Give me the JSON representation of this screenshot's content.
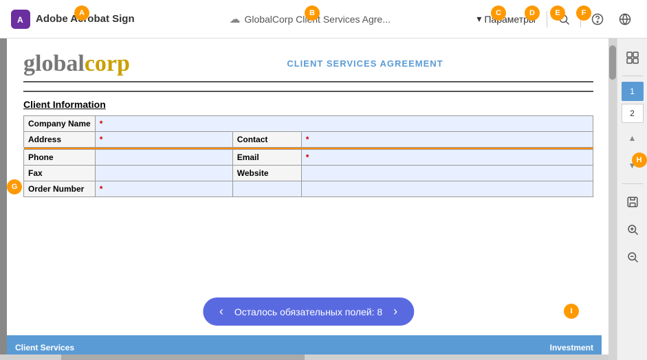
{
  "header": {
    "logo_text": "Adobe Acrobat Sign",
    "document_title": "GlobalCorp Client Services Agre...",
    "cloud_icon": "☁",
    "params_label": "Параметры",
    "chevron": "▾",
    "search_icon": "🔍",
    "help_icon": "?",
    "globe_icon": "🌐"
  },
  "annotations": {
    "A": "A",
    "B": "B",
    "C": "C",
    "D": "D",
    "E": "E",
    "F": "F",
    "G": "G",
    "H": "H",
    "I": "I"
  },
  "document": {
    "logo_left": "global",
    "logo_right": "corp",
    "agreement_title": "CLIENT SERVICES AGREEMENT",
    "section_title": "Client Information",
    "fields": [
      {
        "label": "Company Name",
        "value": "*",
        "colspan": true
      },
      {
        "label": "Address",
        "value": "*",
        "side_label": "Contact",
        "side_value": "*"
      },
      {
        "label": "Phone",
        "value": "",
        "side_label": "Email",
        "side_value": "*"
      },
      {
        "label": "Fax",
        "value": "",
        "side_label": "Website",
        "side_value": ""
      },
      {
        "label": "Order Number",
        "value": "*",
        "side_label": "",
        "side_value": ""
      }
    ],
    "required_bar": {
      "text": "Осталось обязательных полей: 8",
      "prev": "‹",
      "next": "›"
    },
    "footer_left": "Client Services",
    "footer_right": "Investment"
  },
  "sidebar": {
    "grid_icon": "⊞",
    "page1": "1",
    "page2": "2",
    "chevron_up": "▲",
    "chevron_down": "▼",
    "save_icon": "💾",
    "zoom_in": "🔍",
    "zoom_out": "🔍"
  }
}
